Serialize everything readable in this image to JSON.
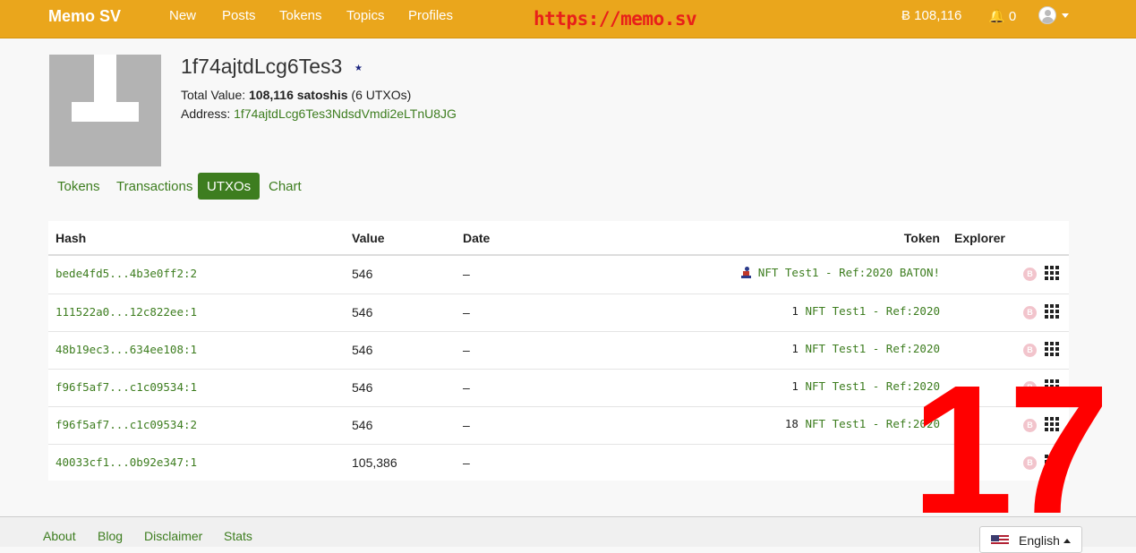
{
  "navbar": {
    "brand": "Memo SV",
    "links": [
      "New",
      "Posts",
      "Tokens",
      "Topics",
      "Profiles"
    ],
    "watermark_url": "https://memo.sv",
    "balance": "Ƀ 108,116",
    "notifications": "🔔 0",
    "accent_color": "#eaa61c"
  },
  "profile": {
    "name": "1f74ajtdLcg6Tes3",
    "star": "★",
    "total_label": "Total Value: ",
    "total_value": "108,116 satoshis",
    "total_suffix": " (6 UTXOs)",
    "address_label": "Address: ",
    "address": "1f74ajtdLcg6Tes3NdsdVmdi2eLTnU8JG"
  },
  "tabs": [
    {
      "label": "Tokens",
      "active": false
    },
    {
      "label": "Transactions",
      "active": false
    },
    {
      "label": "UTXOs",
      "active": true
    },
    {
      "label": "Chart",
      "active": false
    }
  ],
  "table": {
    "headers": {
      "hash": "Hash",
      "value": "Value",
      "date": "Date",
      "token": "Token",
      "explorer": "Explorer"
    },
    "rows": [
      {
        "hash": "bede4fd5...4b3e0ff2:2",
        "value": "546",
        "date": "–",
        "token_qty": "",
        "token_name": "NFT Test1 - Ref:2020 BATON!",
        "baton_icon": true
      },
      {
        "hash": "111522a0...12c822ee:1",
        "value": "546",
        "date": "–",
        "token_qty": "1 ",
        "token_name": "NFT Test1 - Ref:2020",
        "baton_icon": false
      },
      {
        "hash": "48b19ec3...634ee108:1",
        "value": "546",
        "date": "–",
        "token_qty": "1 ",
        "token_name": "NFT Test1 - Ref:2020",
        "baton_icon": false
      },
      {
        "hash": "f96f5af7...c1c09534:1",
        "value": "546",
        "date": "–",
        "token_qty": "1 ",
        "token_name": "NFT Test1 - Ref:2020",
        "baton_icon": false
      },
      {
        "hash": "f96f5af7...c1c09534:2",
        "value": "546",
        "date": "–",
        "token_qty": "18 ",
        "token_name": "NFT Test1 - Ref:2020",
        "baton_icon": false
      },
      {
        "hash": "40033cf1...0b92e347:1",
        "value": "105,386",
        "date": "–",
        "token_qty": "",
        "token_name": "",
        "baton_icon": false
      }
    ],
    "bsv_icon_glyph": "B"
  },
  "overlay_number": "17",
  "footer": {
    "links": [
      "About",
      "Blog",
      "Disclaimer",
      "Stats"
    ],
    "language": "English"
  }
}
